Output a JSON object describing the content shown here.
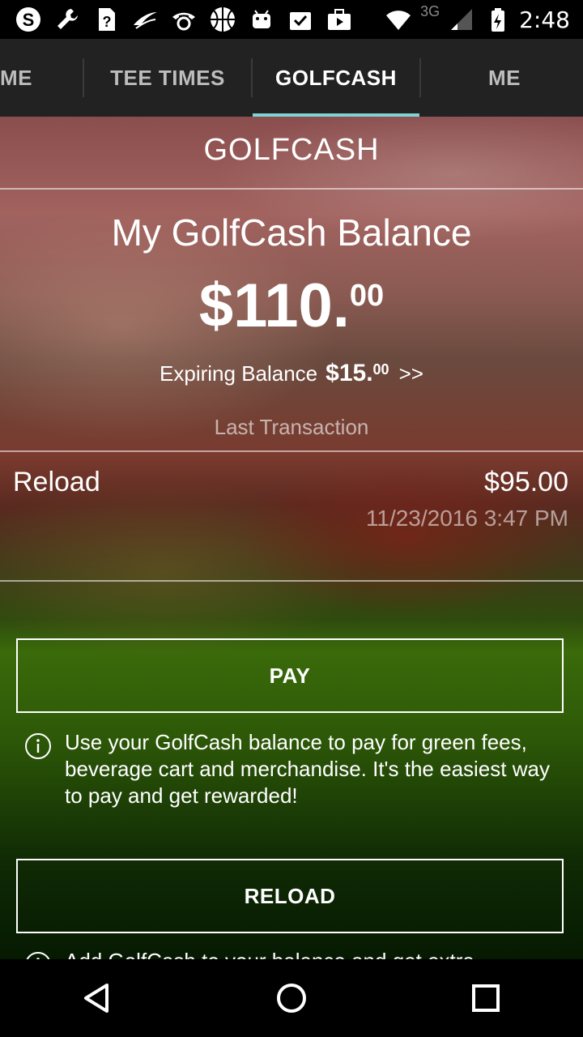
{
  "status_bar": {
    "time": "2:48",
    "network": "3G",
    "icons": [
      "skype-icon",
      "wrench-icon",
      "help-icon",
      "swoosh-icon",
      "voicemail-icon",
      "basketball-icon",
      "android-icon",
      "clipboard-check-icon",
      "briefcase-icon",
      "wifi-icon",
      "signal-icon",
      "battery-charging-icon"
    ]
  },
  "tabs": [
    {
      "label": "ME",
      "active": false
    },
    {
      "label": "TEE TIMES",
      "active": false
    },
    {
      "label": "GOLFCASH",
      "active": true
    },
    {
      "label": "ME",
      "active": false
    }
  ],
  "page": {
    "title": "GOLFCASH",
    "balance_heading": "My GolfCash Balance",
    "balance_main": "$110.",
    "balance_cents": "00",
    "expiring_label": "Expiring Balance",
    "expiring_main": "$15.",
    "expiring_cents": "00",
    "expiring_arrow": ">>",
    "last_transaction_label": "Last Transaction"
  },
  "last_transaction": {
    "type": "Reload",
    "amount": "$95.00",
    "datetime": "11/23/2016 3:47 PM"
  },
  "actions": {
    "pay_label": "PAY",
    "pay_info": "Use your GolfCash balance to pay for green fees, beverage cart and merchandise. It's the easiest way to pay and get rewarded!",
    "reload_label": "RELOAD",
    "reload_info": "Add GolfCash to your balance and get extra"
  },
  "colors": {
    "tab_indicator": "#7fd3d4",
    "tab_bar": "#222222"
  }
}
